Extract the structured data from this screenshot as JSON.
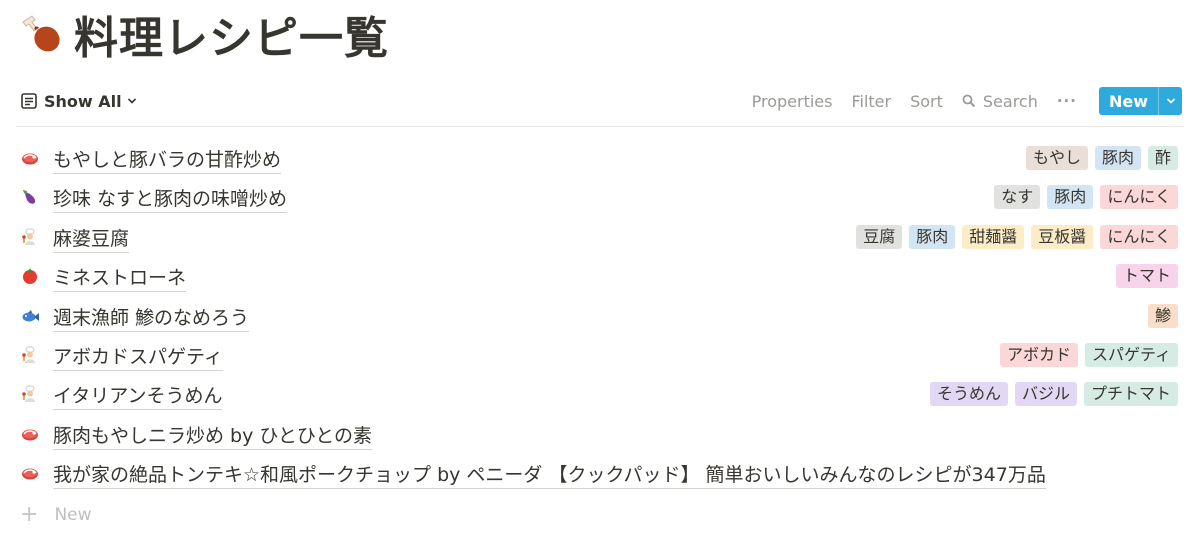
{
  "page": {
    "icon": "poultry-leg-icon",
    "title": "料理レシピ一覧"
  },
  "toolbar": {
    "view_label": "Show All",
    "properties": "Properties",
    "filter": "Filter",
    "sort": "Sort",
    "search": "Search",
    "more": "···",
    "new_label": "New"
  },
  "tag_colors": {
    "brown": "#e9dfd8",
    "blue": "#d3e5f3",
    "green": "#d7ebe5",
    "gray": "#e1e1e0",
    "red": "#fbd7d8",
    "yellow": "#fdecc8",
    "pink": "#f7d4ea",
    "orange": "#fadec9",
    "purple": "#e3d8f4"
  },
  "recipes": [
    {
      "icon": "meat-icon",
      "title": "もやしと豚バラの甘酢炒め",
      "tags": [
        {
          "name": "もやし",
          "color": "#e9dfd8"
        },
        {
          "name": "豚肉",
          "color": "#d3e5f3"
        },
        {
          "name": "酢",
          "color": "#d7ebe5"
        }
      ]
    },
    {
      "icon": "eggplant-icon",
      "title": "珍味 なすと豚肉の味噌炒め",
      "tags": [
        {
          "name": "なす",
          "color": "#e1e1e0"
        },
        {
          "name": "豚肉",
          "color": "#d3e5f3"
        },
        {
          "name": "にんにく",
          "color": "#fbd7d8"
        }
      ]
    },
    {
      "icon": "chef-icon",
      "title": "麻婆豆腐",
      "tags": [
        {
          "name": "豆腐",
          "color": "#e1e1e0"
        },
        {
          "name": "豚肉",
          "color": "#d3e5f3"
        },
        {
          "name": "甜麺醤",
          "color": "#fdecc8"
        },
        {
          "name": "豆板醤",
          "color": "#fdecc8"
        },
        {
          "name": "にんにく",
          "color": "#fbd7d8"
        }
      ]
    },
    {
      "icon": "tomato-icon",
      "title": "ミネストローネ",
      "tags": [
        {
          "name": "トマト",
          "color": "#f7d4ea"
        }
      ]
    },
    {
      "icon": "fish-icon",
      "title": "週末漁師 鯵のなめろう",
      "tags": [
        {
          "name": "鯵",
          "color": "#fadec9"
        }
      ]
    },
    {
      "icon": "chef-icon",
      "title": "アボカドスパゲティ",
      "tags": [
        {
          "name": "アボカド",
          "color": "#fbd7d8"
        },
        {
          "name": "スパゲティ",
          "color": "#d7ebe5"
        }
      ]
    },
    {
      "icon": "chef-icon",
      "title": "イタリアンそうめん",
      "tags": [
        {
          "name": "そうめん",
          "color": "#e3d8f4"
        },
        {
          "name": "バジル",
          "color": "#e3d8f4"
        },
        {
          "name": "プチトマト",
          "color": "#d7ebe5"
        }
      ]
    },
    {
      "icon": "meat-icon",
      "title": "豚肉もやしニラ炒め by ひとひとの素",
      "tags": []
    },
    {
      "icon": "meat-icon",
      "title": "我が家の絶品トンテキ☆和風ポークチョップ by ペニーダ 【クックパッド】 簡単おいしいみんなのレシピが347万品",
      "tags": []
    }
  ],
  "add_new": {
    "label": "New"
  }
}
